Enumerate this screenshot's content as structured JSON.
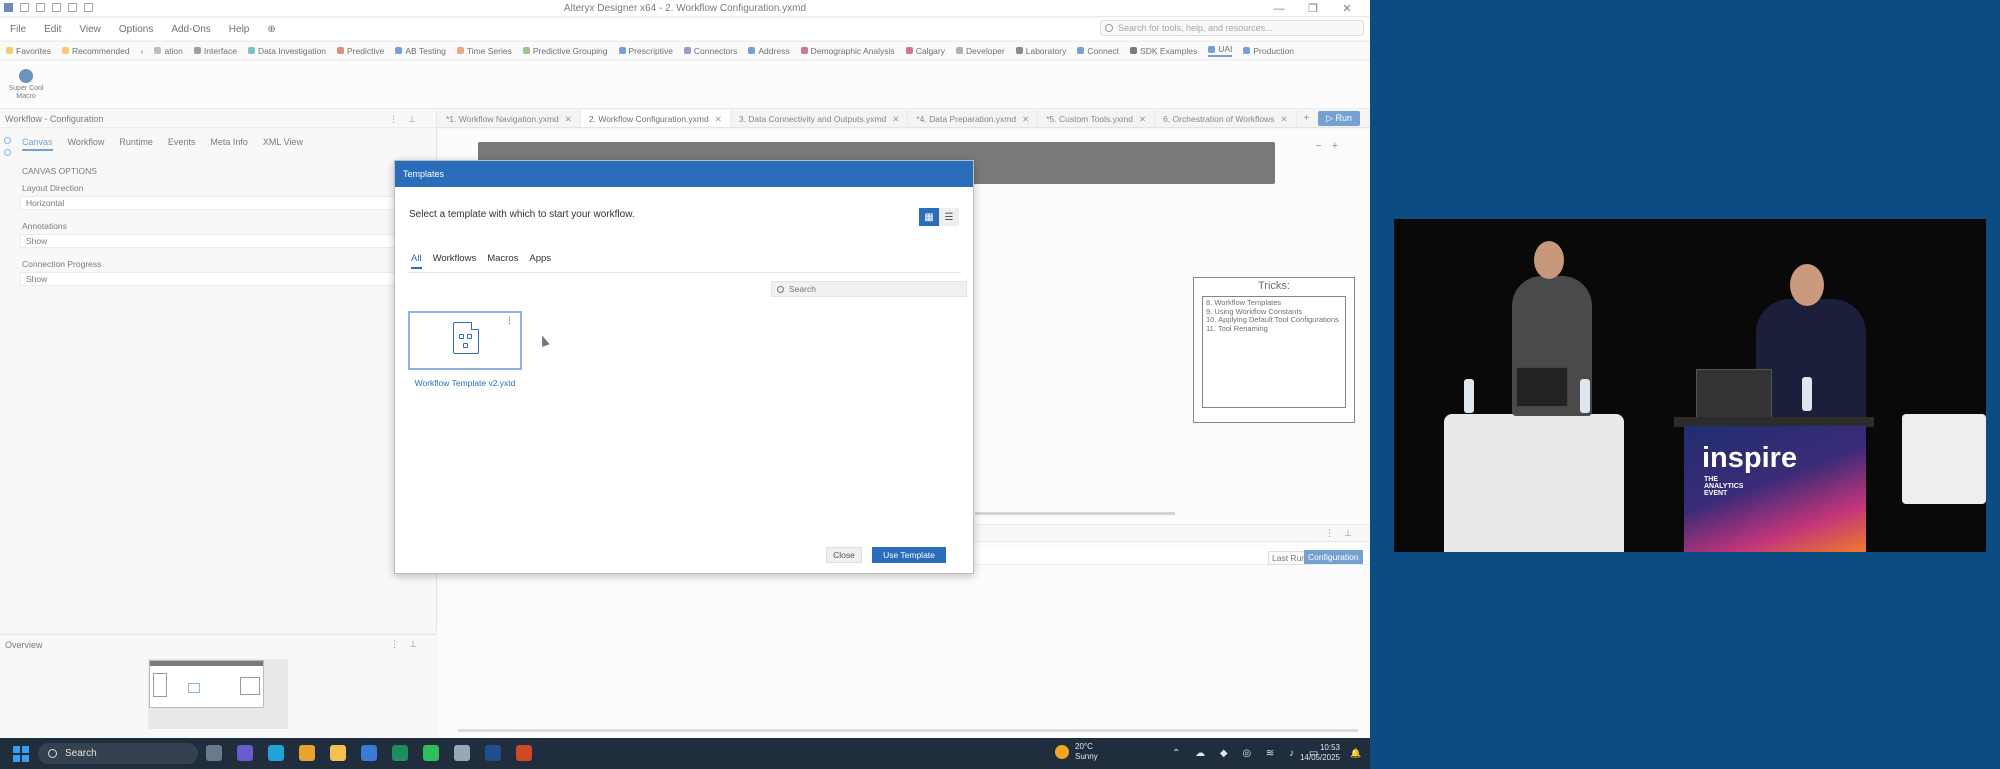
{
  "window": {
    "title": "Alteryx Designer x64 - 2. Workflow Configuration.yxmd"
  },
  "menu": {
    "items": [
      "File",
      "Edit",
      "View",
      "Options",
      "Add-Ons",
      "Help"
    ]
  },
  "global_search": {
    "placeholder": "Search for tools, help, and resources..."
  },
  "tool_categories": [
    {
      "label": "Favorites",
      "color": "#f2b01e"
    },
    {
      "label": "Recommended",
      "color": "#f2b01e"
    },
    {
      "label": "ation",
      "color": "#9a9a9a"
    },
    {
      "label": "Interface",
      "color": "#6b6b6b"
    },
    {
      "label": "Data Investigation",
      "color": "#3aa6a0"
    },
    {
      "label": "Predictive",
      "color": "#c8542a"
    },
    {
      "label": "AB Testing",
      "color": "#2a6ebb"
    },
    {
      "label": "Time Series",
      "color": "#e07b39"
    },
    {
      "label": "Predictive Grouping",
      "color": "#6aa84f"
    },
    {
      "label": "Prescriptive",
      "color": "#2a6ebb"
    },
    {
      "label": "Connectors",
      "color": "#7b5ea7"
    },
    {
      "label": "Address",
      "color": "#2a6ebb"
    },
    {
      "label": "Demographic Analysis",
      "color": "#b5305c"
    },
    {
      "label": "Calgary",
      "color": "#b5305c"
    },
    {
      "label": "Developer",
      "color": "#7f8c8d"
    },
    {
      "label": "Laboratory",
      "color": "#4a4a4a"
    },
    {
      "label": "Connect",
      "color": "#2a6ebb"
    },
    {
      "label": "SDK Examples",
      "color": "#333333"
    },
    {
      "label": "UAI",
      "color": "#2a6ebb"
    },
    {
      "label": "Production",
      "color": "#2a6ebb"
    }
  ],
  "palette": {
    "tool_label": "Super Cool Macro"
  },
  "config_panel": {
    "title": "Workflow - Configuration",
    "tabs": [
      "Canvas",
      "Workflow",
      "Runtime",
      "Events",
      "Meta Info",
      "XML View"
    ],
    "section": "CANVAS OPTIONS",
    "fields": [
      {
        "label": "Layout Direction",
        "value": "Horizontal"
      },
      {
        "label": "Annotations",
        "value": "Show"
      },
      {
        "label": "Connection Progress",
        "value": "Show"
      }
    ]
  },
  "overview": {
    "title": "Overview"
  },
  "doc_tabs": [
    {
      "label": "*1. Workflow Navigation.yxmd"
    },
    {
      "label": "2. Workflow Configuration.yxmd",
      "selected": true
    },
    {
      "label": "3. Data Connectivity and Outputs.yxmd"
    },
    {
      "label": "*4. Data Preparation.yxmd"
    },
    {
      "label": "*5. Custom Tools.yxmd"
    },
    {
      "label": "6. Orchestration of Workflows"
    }
  ],
  "run_button": "Run",
  "tricks": {
    "title": "Tricks:",
    "items": [
      "8. Workflow Templates",
      "9. Using Workflow Constants",
      "10. Applying Default Tool Configurations",
      "11. Tool Renaming"
    ]
  },
  "results": {
    "last_run": "Last Run",
    "configuration": "Configuration"
  },
  "modal": {
    "title": "Templates",
    "prompt": "Select a template with which to start your workflow.",
    "tabs": [
      "All",
      "Workflows",
      "Macros",
      "Apps"
    ],
    "search_placeholder": "Search",
    "template_name": "Workflow Template v2.yxtd",
    "close_label": "Close",
    "use_label": "Use Template"
  },
  "taskbar": {
    "search_label": "Search",
    "weather_temp": "20°C",
    "weather_desc": "Sunny",
    "time": "10:53",
    "date": "14/05/2025"
  },
  "video": {
    "podium_brand": "inspire",
    "podium_sub": [
      "THE",
      "ANALYTICS",
      "EVENT"
    ]
  }
}
